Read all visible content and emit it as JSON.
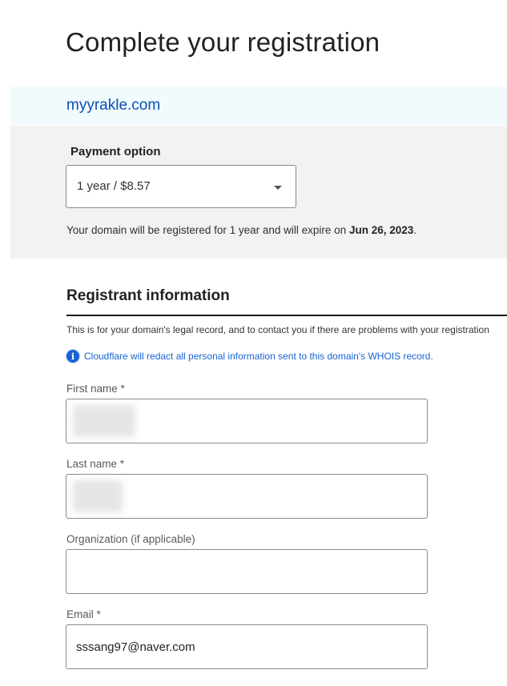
{
  "page": {
    "title": "Complete your registration"
  },
  "domain": {
    "name": "myyrakle.com"
  },
  "payment": {
    "label": "Payment option",
    "selected": "1 year / $8.57",
    "expiry_prefix": "Your domain will be registered for 1 year and will expire on ",
    "expiry_date": "Jun 26, 2023",
    "expiry_suffix": "."
  },
  "registrant": {
    "title": "Registrant information",
    "description": "This is for your domain's legal record, and to contact you if there are problems with your registration",
    "note": "Cloudflare will redact all personal information sent to this domain's WHOIS record.",
    "info_icon": "info-icon",
    "fields": {
      "first_name": {
        "label": "First name *",
        "value": ""
      },
      "last_name": {
        "label": "Last name *",
        "value": ""
      },
      "organization": {
        "label": "Organization (if applicable)",
        "value": ""
      },
      "email": {
        "label": "Email *",
        "value": "sssang97@naver.com"
      }
    }
  },
  "colors": {
    "link_blue": "#0a4fb5",
    "info_blue": "#1863d1",
    "banner_bg": "#f1fbfe",
    "panel_bg": "#f2f2f2"
  }
}
